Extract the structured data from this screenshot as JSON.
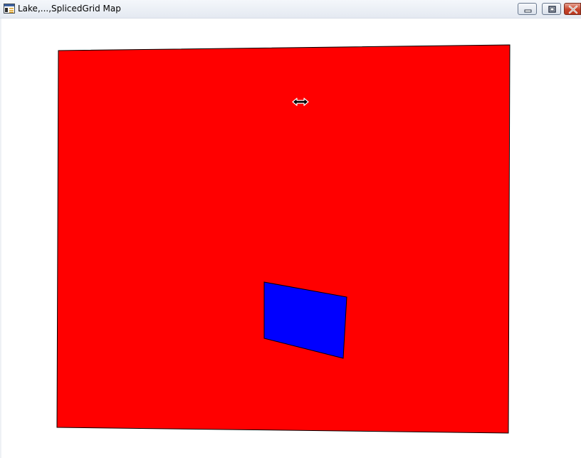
{
  "window": {
    "title": "Lake,...,SplicedGrid Map",
    "controls": {
      "minimize_icon": "minimize-icon",
      "maximize_icon": "restore-icon",
      "close_icon": "close-icon"
    }
  },
  "map": {
    "background_color": "#ffffff",
    "features": [
      {
        "name": "outer-polygon",
        "fill": "#ff0000",
        "stroke": "#000000"
      },
      {
        "name": "inner-polygon",
        "fill": "#0000ff",
        "stroke": "#000000"
      }
    ],
    "cursor_icon": "horizontal-resize-cursor-icon"
  }
}
